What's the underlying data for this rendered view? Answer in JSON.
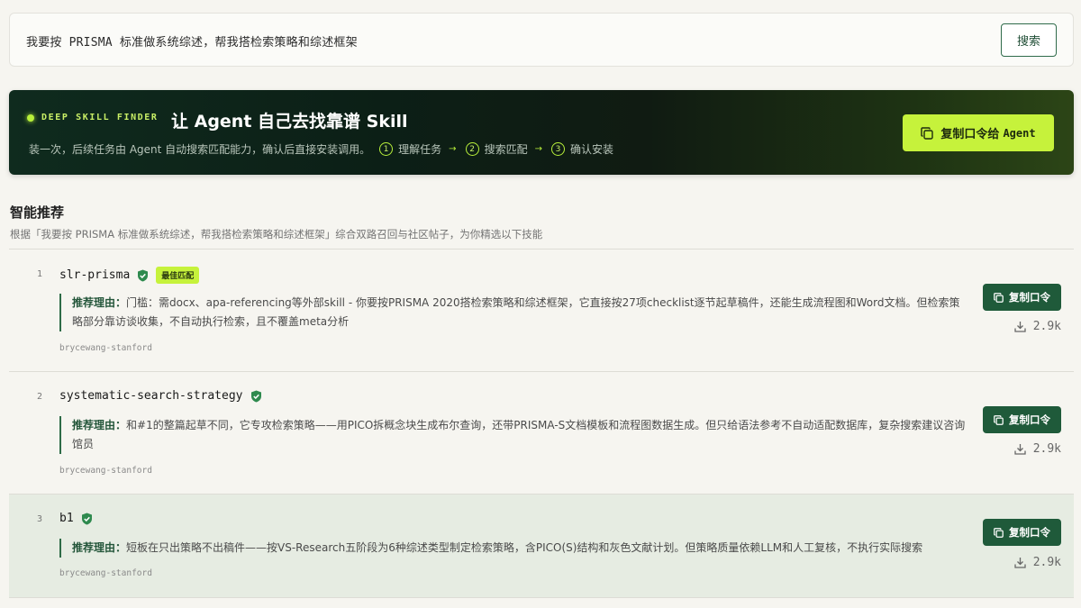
{
  "search": {
    "value": "我要按 PRISMA 标准做系统综述，帮我搭检索策略和综述框架",
    "button_label": "搜索"
  },
  "hero": {
    "tag": "DEEP SKILL FINDER",
    "title": "让 Agent 自己去找靠谱 Skill",
    "subtitle": "装一次，后续任务由 Agent 自动搜索匹配能力，确认后直接安装调用。",
    "steps": [
      {
        "num": "1",
        "label": "理解任务"
      },
      {
        "num": "2",
        "label": "搜索匹配"
      },
      {
        "num": "3",
        "label": "确认安装"
      }
    ],
    "copy_button_label": "复制口令给",
    "copy_button_agent": "Agent"
  },
  "section": {
    "title": "智能推荐",
    "description": "根据「我要按 PRISMA 标准做系统综述，帮我搭检索策略和综述框架」综合双路召回与社区帖子，为你精选以下技能"
  },
  "items": [
    {
      "index": "1",
      "name": "slr-prisma",
      "badge": "最佳匹配",
      "reason_label": "推荐理由：",
      "reason": "门槛：需docx、apa-referencing等外部skill - 你要按PRISMA 2020搭检索策略和综述框架，它直接按27项checklist逐节起草稿件，还能生成流程图和Word文档。但检索策略部分靠访谈收集，不自动执行检索，且不覆盖meta分析",
      "author": "brycewang-stanford",
      "copy_label": "复制口令",
      "downloads": "2.9k"
    },
    {
      "index": "2",
      "name": "systematic-search-strategy",
      "badge": "",
      "reason_label": "推荐理由：",
      "reason": "和#1的整篇起草不同，它专攻检索策略——用PICO拆概念块生成布尔查询，还带PRISMA-S文档模板和流程图数据生成。但只给语法参考不自动适配数据库，复杂搜索建议咨询馆员",
      "author": "brycewang-stanford",
      "copy_label": "复制口令",
      "downloads": "2.9k"
    },
    {
      "index": "3",
      "name": "b1",
      "badge": "",
      "reason_label": "推荐理由：",
      "reason": "短板在只出策略不出稿件——按VS-Research五阶段为6种综述类型制定检索策略，含PICO(S)结构和灰色文献计划。但策略质量依赖LLM和人工复核，不执行实际搜索",
      "author": "brycewang-stanford",
      "copy_label": "复制口令",
      "downloads": "2.9k"
    }
  ],
  "colors": {
    "accent_lime": "#c6f23b",
    "primary_green": "#1f5a3a",
    "hero_dark": "#0f2b1e",
    "highlight_row": "#e6ece2"
  }
}
